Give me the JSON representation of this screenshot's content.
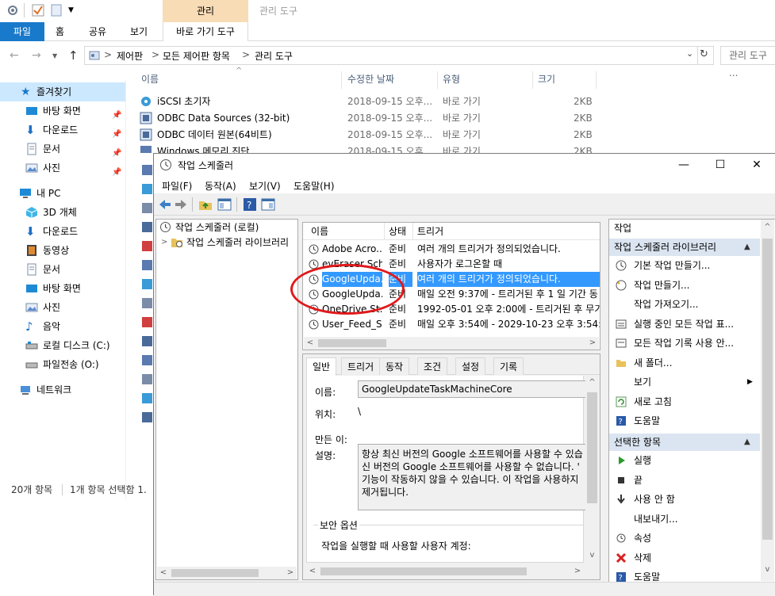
{
  "explorer": {
    "ribbon": {
      "context_tab": "관리",
      "context_title": "관리 도구",
      "tabs": [
        "파일",
        "홈",
        "공유",
        "보기",
        "바로 가기 도구"
      ]
    },
    "address": {
      "crumbs": [
        "제어판",
        "모든 제어판 항목",
        "관리 도구"
      ],
      "separator": ">",
      "search_placeholder": "관리 도구 ..."
    },
    "nav": {
      "favorites": "즐겨찾기",
      "quick": [
        "바탕 화면",
        "다운로드",
        "문서",
        "사진"
      ],
      "this_pc": "내 PC",
      "pc_items": [
        "3D 개체",
        "다운로드",
        "동영상",
        "문서",
        "바탕 화면",
        "사진",
        "음악",
        "로컬 디스크 (C:)",
        "파일전송 (O:)"
      ],
      "network": "네트워크"
    },
    "columns": [
      "이름",
      "수정한 날짜",
      "유형",
      "크기"
    ],
    "files": [
      {
        "name": "iSCSI 초기자",
        "date": "2018-09-15 오후...",
        "type": "바로 가기",
        "size": "2KB"
      },
      {
        "name": "ODBC Data Sources (32-bit)",
        "date": "2018-09-15 오후...",
        "type": "바로 가기",
        "size": "2KB"
      },
      {
        "name": "ODBC 데이터 원본(64비트)",
        "date": "2018-09-15 오후...",
        "type": "바로 가기",
        "size": "2KB"
      },
      {
        "name": "Windows 메모리 진단",
        "date": "2018-09-15 오후...",
        "type": "바로 가기",
        "size": "2KB"
      }
    ],
    "status": {
      "count": "20개 항목",
      "selection": "1개 항목 선택함 1."
    }
  },
  "scheduler": {
    "title": "작업 스케줄러",
    "window_buttons": {
      "minimize": "—",
      "maximize": "☐",
      "close": "✕"
    },
    "menu": [
      "파일(F)",
      "동작(A)",
      "보기(V)",
      "도움말(H)"
    ],
    "tree": {
      "root": "작업 스케줄러 (로컬)",
      "library": "작업 스케줄러 라이브러리"
    },
    "list_columns": [
      "이름",
      "상태",
      "트리거"
    ],
    "tasks": [
      {
        "name": "Adobe Acro...",
        "status": "준비",
        "trigger": "여러 개의 트리거가 정의되었습니다."
      },
      {
        "name": "evEraser Sch...",
        "status": "준비",
        "trigger": "사용자가 로그온할 때"
      },
      {
        "name": "GoogleUpda...",
        "status": "준비",
        "trigger": "여러 개의 트리거가 정의되었습니다."
      },
      {
        "name": "GoogleUpda...",
        "status": "준비",
        "trigger": "매일 오전 9:37에 - 트리거된 후 1 일 기간 동"
      },
      {
        "name": "OneDrive St...",
        "status": "준비",
        "trigger": "1992-05-01 오후 2:00에 - 트리거된 후 무기"
      },
      {
        "name": "User_Feed_S...",
        "status": "준비",
        "trigger": "매일 오후 3:54에 - 2029-10-23 오후 3:54:"
      }
    ],
    "selected_index": 2,
    "detail_tabs": [
      "일반",
      "트리거",
      "동작",
      "조건",
      "설정",
      "기록"
    ],
    "detail": {
      "name_label": "이름:",
      "name_value": "GoogleUpdateTaskMachineCore",
      "location_label": "위치:",
      "location_value": "\\",
      "author_label": "만든 이:",
      "desc_label": "설명:",
      "desc_lines": [
        "항상 최신 버전의 Google 소프트웨어를 사용할 수 있습",
        "신 버전의 Google 소프트웨어를 사용할 수 없습니다. '",
        "기능이 작동하지 않을 수 있습니다. 이 작업을 사용하지",
        "제거됩니다."
      ],
      "security_label": "보안 옵션",
      "security_text": "작업을 실행할 때 사용할 사용자 계정:"
    },
    "actions": {
      "header": "작업",
      "section1": "작업 스케줄러 라이브러리",
      "items1": [
        "기본 작업 만들기...",
        "작업 만들기...",
        "작업 가져오기...",
        "실행 중인 모든 작업 표...",
        "모든 작업 기록 사용 안...",
        "새 폴더...",
        "보기",
        "새로 고침",
        "도움말"
      ],
      "section2": "선택한 항목",
      "items2": [
        "실행",
        "끝",
        "사용 안 함",
        "내보내기...",
        "속성",
        "삭제",
        "도움말"
      ]
    }
  }
}
